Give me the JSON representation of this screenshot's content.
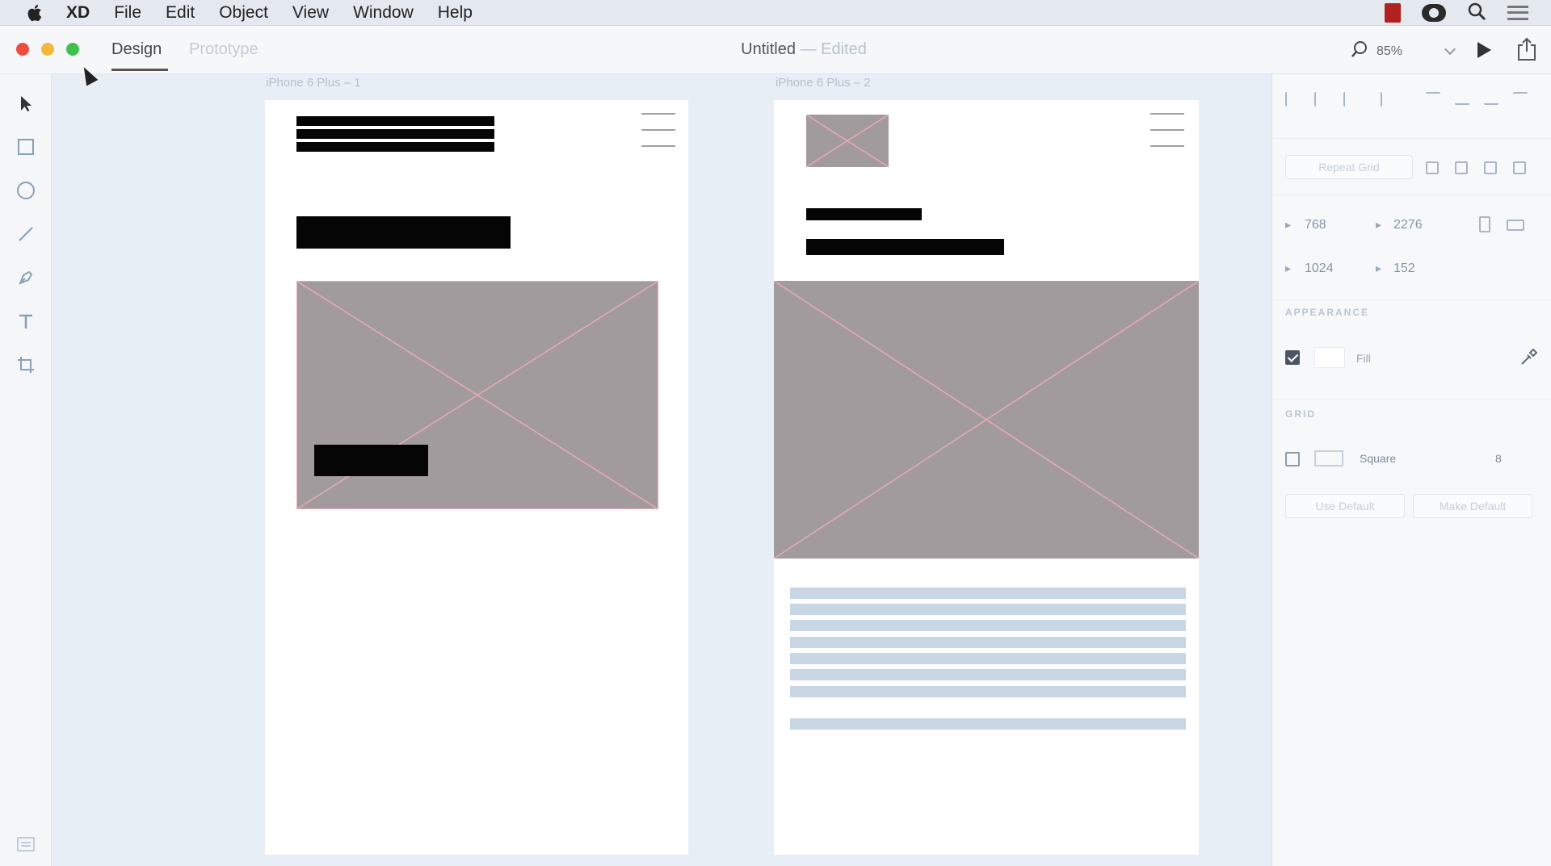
{
  "menubar": {
    "app_name": "XD",
    "items": [
      "File",
      "Edit",
      "Object",
      "View",
      "Window",
      "Help"
    ]
  },
  "titlebar": {
    "tabs": {
      "design": "Design",
      "prototype": "Prototype"
    },
    "document_name": "Untitled",
    "document_state": "— Edited",
    "zoom": "85%"
  },
  "tools": [
    "select-tool",
    "rectangle-tool",
    "ellipse-tool",
    "line-tool",
    "pen-tool",
    "text-tool",
    "artboard-tool"
  ],
  "artboards": [
    {
      "label": "iPhone 6 Plus – 1"
    },
    {
      "label": "iPhone 6 Plus – 2"
    }
  ],
  "panel": {
    "repeat_grid": "Repeat Grid",
    "width": "768",
    "x": "2276",
    "height": "1024",
    "y": "152",
    "appearance_heading": "APPEARANCE",
    "fill_label": "Fill",
    "fill_checked": true,
    "grid_heading": "GRID",
    "grid_type": "Square",
    "grid_size": "8",
    "grid_checked": false,
    "use_default": "Use Default",
    "make_default": "Make Default"
  },
  "colors": {
    "canvas": "#e8eef6",
    "placeholder": "#a29b9e",
    "placeholder_cross": "#e8a9b5",
    "text_line": "#c9d6e3"
  }
}
